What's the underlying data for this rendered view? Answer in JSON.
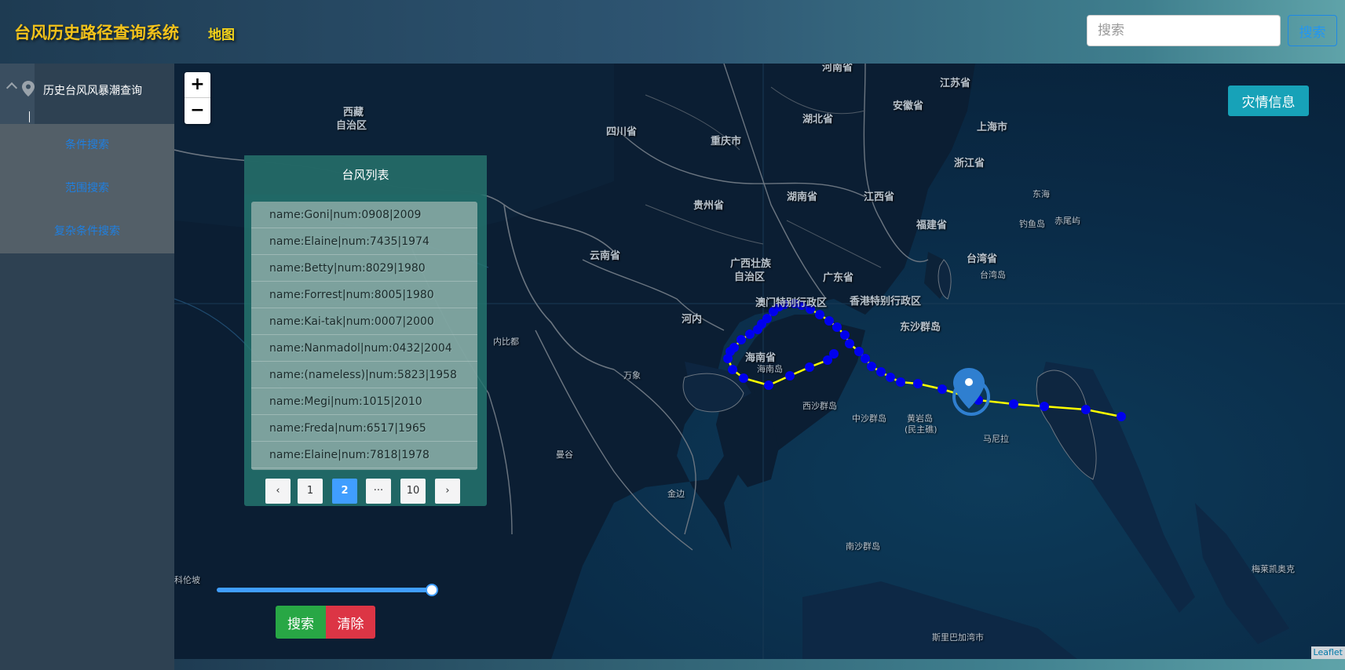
{
  "header": {
    "app_title": "台风历史路径查询系统",
    "nav_map": "地图",
    "search_placeholder": "搜索",
    "search_button": "搜索"
  },
  "sidebar": {
    "group_title": "历史台风风暴潮查询",
    "items": [
      {
        "label": "条件搜索"
      },
      {
        "label": "范围搜索"
      },
      {
        "label": "复杂条件搜索"
      }
    ]
  },
  "map": {
    "zoom_in": "+",
    "zoom_out": "−",
    "disaster_button": "灾情信息",
    "attribution": "Leaflet",
    "labels": [
      "河南省",
      "江苏省",
      "安徽省",
      "湖北省",
      "上海市",
      "西藏",
      "自治区",
      "四川省",
      "重庆市",
      "浙江省",
      "贵州省",
      "湖南省",
      "江西省",
      "东海",
      "福建省",
      "钓鱼岛",
      "赤尾屿",
      "云南省",
      "台湾省",
      "台湾岛",
      "广西壮族",
      "自治区",
      "广东省",
      "澳门特别行政区",
      "香港特别行政区",
      "河内",
      "东沙群岛",
      "内比都",
      "海南省",
      "海南岛",
      "万象",
      "西沙群岛",
      "中沙群岛",
      "黄岩岛",
      "(民主礁)",
      "马尼拉",
      "曼谷",
      "金边",
      "南沙群岛",
      "斯里巴加湾市",
      "科伦坡",
      "梅莱凯奥克"
    ]
  },
  "typhoon_panel": {
    "title": "台风列表",
    "rows": [
      "name:Goni|num:0908|2009",
      "name:Elaine|num:7435|1974",
      "name:Betty|num:8029|1980",
      "name:Forrest|num:8005|1980",
      "name:Kai-tak|num:0007|2000",
      "name:Nanmadol|num:0432|2004",
      "name:(nameless)|num:5823|1958",
      "name:Megi|num:1015|2010",
      "name:Freda|num:6517|1965",
      "name:Elaine|num:7818|1978"
    ],
    "pager": {
      "prev": "‹",
      "pages": [
        "1",
        "2",
        "···",
        "10"
      ],
      "active": "2",
      "next": "›"
    }
  },
  "controls": {
    "slider_value": 1.0,
    "search_label": "搜索",
    "clear_label": "清除"
  },
  "colors": {
    "title_yellow": "#f3c21a",
    "track_line": "#ffff00",
    "track_point": "#0000ee",
    "marker": "#2f7fd0",
    "accent": "#409eff",
    "disaster_button": "#17a2b8"
  }
}
